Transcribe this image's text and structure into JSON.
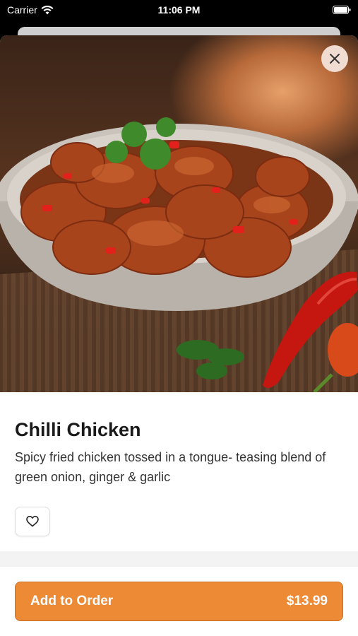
{
  "status_bar": {
    "carrier": "Carrier",
    "time": "11:06 PM"
  },
  "item": {
    "name": "Chilli Chicken",
    "description": "Spicy fried chicken tossed in a tongue- teasing blend of green onion, ginger & garlic",
    "image_alt": "Bowl of chilli chicken garnished with cilantro and red chilies"
  },
  "actions": {
    "add_label": "Add to Order",
    "price": "$13.99"
  },
  "colors": {
    "accent": "#ed8a36",
    "accent_border": "#c86f24"
  },
  "icons": {
    "close": "close-icon",
    "favorite": "heart-icon",
    "wifi": "wifi-icon",
    "battery": "battery-icon"
  }
}
